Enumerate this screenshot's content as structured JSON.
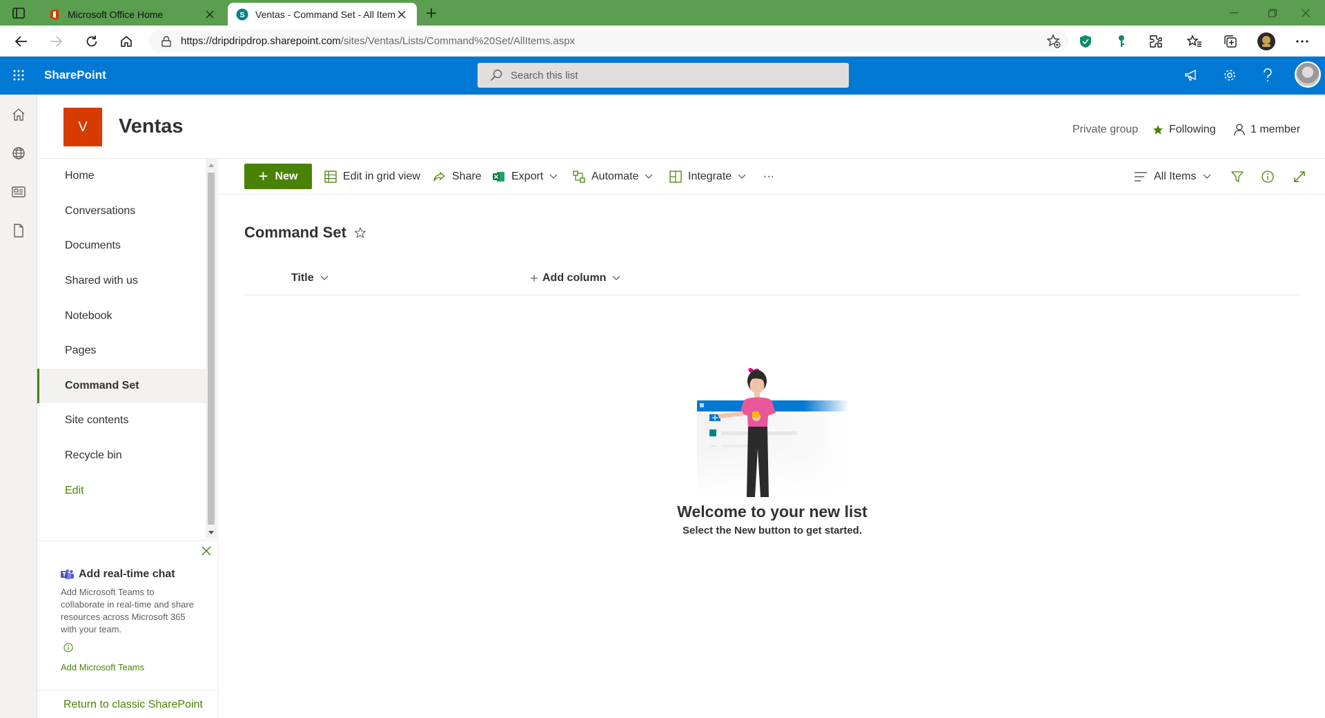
{
  "browser": {
    "tabs": [
      {
        "title": "Microsoft Office Home",
        "active": false
      },
      {
        "title": "Ventas - Command Set - All Items",
        "active": true
      }
    ],
    "url_host": "https://dripdripdrop.sharepoint.com",
    "url_path": "/sites/Ventas/Lists/Command%20Set/AllItems.aspx"
  },
  "suitebar": {
    "brand": "SharePoint",
    "search_placeholder": "Search this list"
  },
  "site": {
    "logo_letter": "V",
    "title": "Ventas",
    "privacy": "Private group",
    "following": "Following",
    "members": "1 member"
  },
  "nav": {
    "items": [
      {
        "label": "Home"
      },
      {
        "label": "Conversations"
      },
      {
        "label": "Documents"
      },
      {
        "label": "Shared with us"
      },
      {
        "label": "Notebook"
      },
      {
        "label": "Pages"
      },
      {
        "label": "Command Set",
        "selected": true
      },
      {
        "label": "Site contents"
      },
      {
        "label": "Recycle bin"
      },
      {
        "label": "Edit"
      }
    ],
    "teams_card": {
      "title": "Add real-time chat",
      "description": "Add Microsoft Teams to collaborate in real-time and share resources across Microsoft 365 with your team.",
      "link": "Add Microsoft Teams"
    },
    "classic_link": "Return to classic SharePoint"
  },
  "commandbar": {
    "new": "New",
    "edit_grid": "Edit in grid view",
    "share": "Share",
    "export": "Export",
    "automate": "Automate",
    "integrate": "Integrate",
    "more": "···",
    "view": "All Items"
  },
  "list": {
    "title": "Command Set",
    "columns": [
      "Title",
      "Add column"
    ],
    "empty_title": "Welcome to your new list",
    "empty_subtitle": "Select the New button to get started."
  },
  "colors": {
    "tabbar": "#5a9e4f",
    "suitebar": "#0078d4",
    "accent_green": "#498205",
    "site_logo": "#d83b01"
  }
}
